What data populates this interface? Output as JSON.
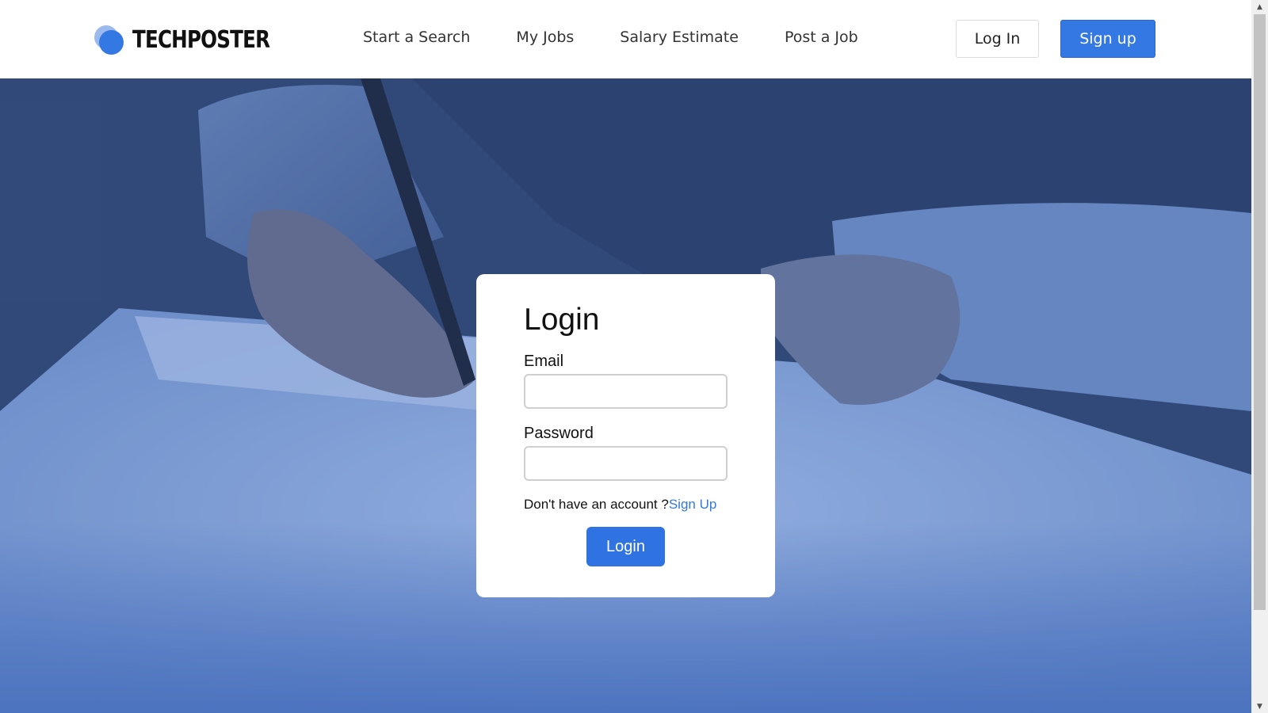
{
  "brand": {
    "name": "TECHPOSTER",
    "colors": {
      "primary": "#3478e3",
      "logo_light": "#9cb9ee"
    }
  },
  "nav": {
    "items": [
      {
        "label": "Start a Search"
      },
      {
        "label": "My Jobs"
      },
      {
        "label": "Salary Estimate"
      },
      {
        "label": "Post a Job"
      }
    ]
  },
  "header_actions": {
    "login_label": "Log In",
    "signup_label": "Sign up"
  },
  "login_form": {
    "title": "Login",
    "email_label": "Email",
    "email_value": "",
    "password_label": "Password",
    "password_value": "",
    "no_account_text": "Don't have an account ?",
    "signup_link_label": "Sign Up",
    "submit_label": "Login"
  },
  "hero": {
    "image": "person-signing-document-photo"
  },
  "scrollbar": {
    "up_icon": "scroll-up-arrow-icon",
    "down_icon": "scroll-down-arrow-icon"
  }
}
